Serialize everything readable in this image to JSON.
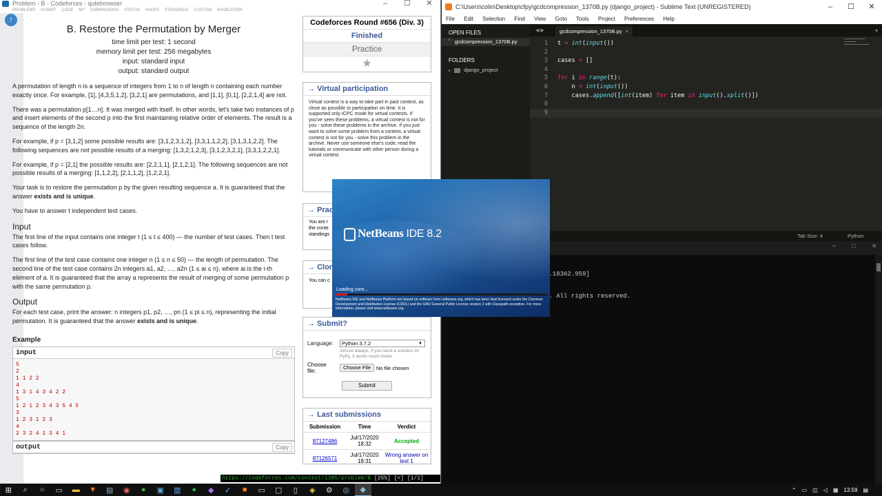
{
  "browser": {
    "title": "Problem - B - Codeforces - qutebrowser",
    "nav_items": [
      "PROBLEMS",
      "SUBMIT CODE",
      "MY SUBMISSIONS",
      "STATUS",
      "HACKS",
      "STANDINGS",
      "CUSTOM INVOCATION"
    ],
    "status_url": "https://codeforces.com/contest/1385/problem/B",
    "status_extra": " [25%] [<] [1/1]"
  },
  "problem": {
    "title": "B. Restore the Permutation by Merger",
    "time_limit": "time limit per test: 1 second",
    "memory_limit": "memory limit per test: 256 megabytes",
    "input_file": "input: standard input",
    "output_file": "output: standard output",
    "p1": "A permutation of length n is a sequence of integers from 1 to n of length n containing each number exactly once. For example, [1], [4,3,5,1,2], [3,2,1] are permutations, and [1,1], [0,1], [2,2,1,4] are not.",
    "p2": "There was a permutation p[1…n]. It was merged with itself. In other words, let's take two instances of p and insert elements of the second p into the first maintaining relative order of elements. The result is a sequence of the length 2n.",
    "p3": "For example, if p = [3,1,2] some possible results are: [3,1,2,3,1,2], [3,3,1,1,2,2], [3,1,3,1,2,2]. The following sequences are not possible results of a merging: [1,3,2,1,2,3], [3,1,2,3,2,1], [3,3,1,2,2,1].",
    "p4": "For example, if p = [2,1] the possible results are: [2,2,1,1], [2,1,2,1]. The following sequences are not possible results of a merging: [1,1,2,2], [2,1,1,2], [1,2,2,1].",
    "p5a": "Your task is to restore the permutation p by the given resulting sequence a. It is guaranteed that the answer ",
    "p5b": "exists and is unique",
    "p5c": ".",
    "p6": "You have to answer t independent test cases.",
    "input_heading": "Input",
    "input_p1": "The first line of the input contains one integer t (1 ≤ t ≤ 400) — the number of test cases. Then t test cases follow.",
    "input_p2": "The first line of the test case contains one integer n (1 ≤ n ≤ 50) — the length of permutation. The second line of the test case contains 2n integers a1, a2, …, a2n (1 ≤ ai ≤ n), where ai is the i-th element of a. It is guaranteed that the array a represents the result of merging of some permutation p with the same permutation p.",
    "output_heading": "Output",
    "output_p1a": "For each test case, print the answer: n integers p1, p2, …, pn (1 ≤ pi ≤ n), representing the initial permutation. It is guaranteed that the answer ",
    "output_p1b": "exists and is unique",
    "output_p1c": ".",
    "example_heading": "Example",
    "input_label": "input",
    "output_label": "output",
    "copy_label": "Copy",
    "example_input": [
      "5",
      "2",
      "1 1 2 2",
      "4",
      "1 3 1 4 3 4 2 2",
      "5",
      "1 2 1 2 3 4 3 5 4 5",
      "3",
      "1 2 3 1 2 3",
      "4",
      "2 3 2 4 1 3 4 1"
    ]
  },
  "sidebar": {
    "round_title": "Codeforces Round #656 (Div. 3)",
    "round_status": "Finished",
    "round_mode": "Practice",
    "vp_title": "Virtual participation",
    "vp_text": "Virtual contest is a way to take part in past contest, as close as possible to participation on time. It is supported only ICPC mode for virtual contests. If you've seen these problems, a virtual contest is not for you - solve these problems in the archive. If you just want to solve some problem from a contest, a virtual contest is not for you - solve this problem in the archive. Never use someone else's code, read the tutorials or communicate with other person during a virtual contest.",
    "practice_title": "Prac",
    "practice_text": "You are r\nthe conte\nstandings",
    "clone_title": "Clon",
    "clone_text": "You can c",
    "submit_title": "Submit?",
    "language_label": "Language:",
    "language_value": "Python 3.7.2",
    "language_hint": "Almost always, if you send a solution on PyPy, it works much faster",
    "file_label": "Choose file:",
    "choose_file": "Choose File",
    "no_file": "No file chosen",
    "submit_button": "Submit",
    "last_title": "Last submissions",
    "col_submission": "Submission",
    "col_time": "Time",
    "col_verdict": "Verdict",
    "rows": [
      {
        "id": "87127486",
        "time": "Jul/17/2020 18:32",
        "verdict": "Accepted"
      },
      {
        "id": "87126571",
        "time": "Jul/17/2020 18:31",
        "verdict": "Wrong answer on test 1"
      }
    ]
  },
  "sublime": {
    "title": "C:\\Users\\colin\\Desktop\\cfpy\\gcdcompression_1370B.py (django_project) - Sublime Text (UNREGISTERED)",
    "menu": [
      "File",
      "Edit",
      "Selection",
      "Find",
      "View",
      "Goto",
      "Tools",
      "Project",
      "Preferences",
      "Help"
    ],
    "open_files_label": "OPEN FILES",
    "open_file": "gcdcompression_1370B.py",
    "folders_label": "FOLDERS",
    "folder": "django_project",
    "tab_name": "gcdcompression_1370B.py",
    "line_numbers": [
      "1",
      "2",
      "3",
      "4",
      "5",
      "6",
      "7",
      "8",
      "9"
    ],
    "tab_size": "Tab Size: 4",
    "syntax": "Python"
  },
  "terminal": {
    "line1": "0.18362.959]",
    "line2": "n. All rights reserved."
  },
  "netbeans": {
    "brand": "NetBeans",
    "ide": "IDE 8.2",
    "loading": "Loading core...",
    "progress": 0.06,
    "legal": "NetBeans IDE and NetBeans Platform are based on software from netbeans.org, which has been dual licensed under the Common Development and Distribution License (CDDL) and the GNU General Public License version 2 with Classpath exception. For more information, please visit www.netbeans.org."
  },
  "taskbar": {
    "clock": "13:59"
  }
}
